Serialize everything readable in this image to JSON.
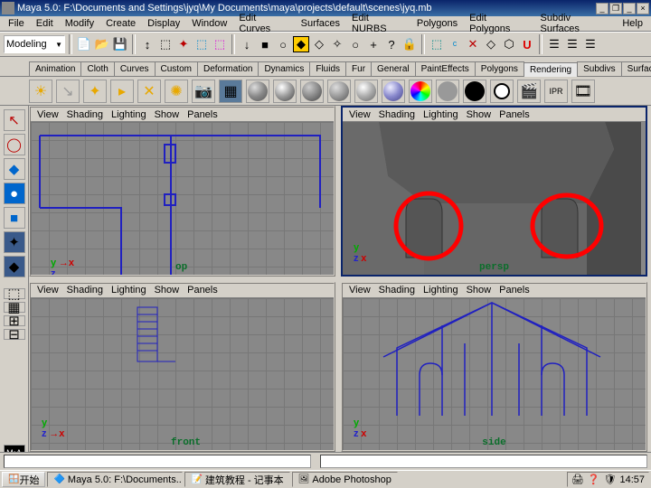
{
  "title": "Maya 5.0: F:\\Documents and Settings\\jyq\\My Documents\\maya\\projects\\default\\scenes\\jyq.mb",
  "menus": [
    "File",
    "Edit",
    "Modify",
    "Create",
    "Display",
    "Window",
    "Edit Curves",
    "Surfaces",
    "Edit NURBS",
    "Polygons",
    "Edit Polygons",
    "Subdiv Surfaces",
    "Help"
  ],
  "mode": "Modeling",
  "tabs": [
    "Animation",
    "Cloth",
    "Curves",
    "Custom",
    "Deformation",
    "Dynamics",
    "Fluids",
    "Fur",
    "General",
    "PaintEffects",
    "Polygons",
    "Rendering",
    "Subdivs",
    "Surfaces"
  ],
  "active_tab": "Rendering",
  "viewport_menus": [
    "View",
    "Shading",
    "Lighting",
    "Show",
    "Panels"
  ],
  "viewports": {
    "top": {
      "label": "op"
    },
    "persp": {
      "label": "persp"
    },
    "front": {
      "label": "front"
    },
    "side": {
      "label": "side"
    }
  },
  "taskbar": {
    "start": "开始",
    "items": [
      "Maya 5.0: F:\\Documents...",
      "建筑教程 - 记事本",
      "Adobe Photoshop"
    ],
    "time": "14:57"
  }
}
